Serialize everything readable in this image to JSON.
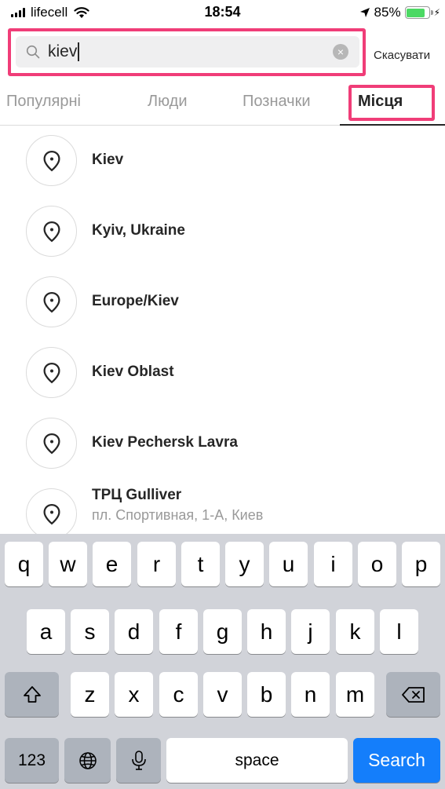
{
  "status_bar": {
    "carrier": "lifecell",
    "time": "18:54",
    "battery": "85%",
    "battery_level": 0.85
  },
  "search": {
    "query": "kiev",
    "cancel_label": "Скасувати"
  },
  "tabs": [
    {
      "label": "Популярні",
      "active": false
    },
    {
      "label": "Люди",
      "active": false
    },
    {
      "label": "Позначки",
      "active": false
    },
    {
      "label": "Місця",
      "active": true
    }
  ],
  "results": [
    {
      "name": "Kiev",
      "subtitle": ""
    },
    {
      "name": "Kyiv, Ukraine",
      "subtitle": ""
    },
    {
      "name": "Europe/Kiev",
      "subtitle": ""
    },
    {
      "name": "Kiev Oblast",
      "subtitle": ""
    },
    {
      "name": "Kiev Pechersk Lavra",
      "subtitle": ""
    },
    {
      "name": "ТРЦ Gulliver",
      "subtitle": "пл. Спортивная, 1-А, Киев"
    }
  ],
  "keyboard": {
    "row1": [
      "q",
      "w",
      "e",
      "r",
      "t",
      "y",
      "u",
      "i",
      "o",
      "p"
    ],
    "row2": [
      "a",
      "s",
      "d",
      "f",
      "g",
      "h",
      "j",
      "k",
      "l"
    ],
    "row3": [
      "z",
      "x",
      "c",
      "v",
      "b",
      "n",
      "m"
    ],
    "numbers_key": "123",
    "space_key": "space",
    "search_key": "Search"
  },
  "colors": {
    "highlight": "#f03d78",
    "accent": "#147efb",
    "battery": "#4cd964"
  }
}
